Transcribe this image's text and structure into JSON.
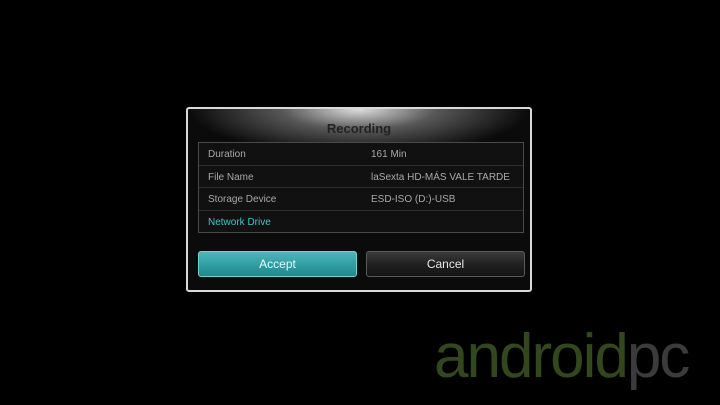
{
  "dialog": {
    "title": "Recording",
    "rows": [
      {
        "label": "Duration",
        "value": "161 Min"
      },
      {
        "label": "File Name",
        "value": "laSexta HD-MÁS VALE TARDE"
      },
      {
        "label": "Storage Device",
        "value": "ESD-ISO (D:)-USB"
      },
      {
        "label": "Network Drive",
        "value": ""
      }
    ],
    "accept_label": "Accept",
    "cancel_label": "Cancel"
  },
  "watermark": {
    "main": "android",
    "accent": "pc"
  },
  "colors": {
    "background": "#000000",
    "accent": "#3ec6c9",
    "accept_button": "#2f9da2"
  }
}
